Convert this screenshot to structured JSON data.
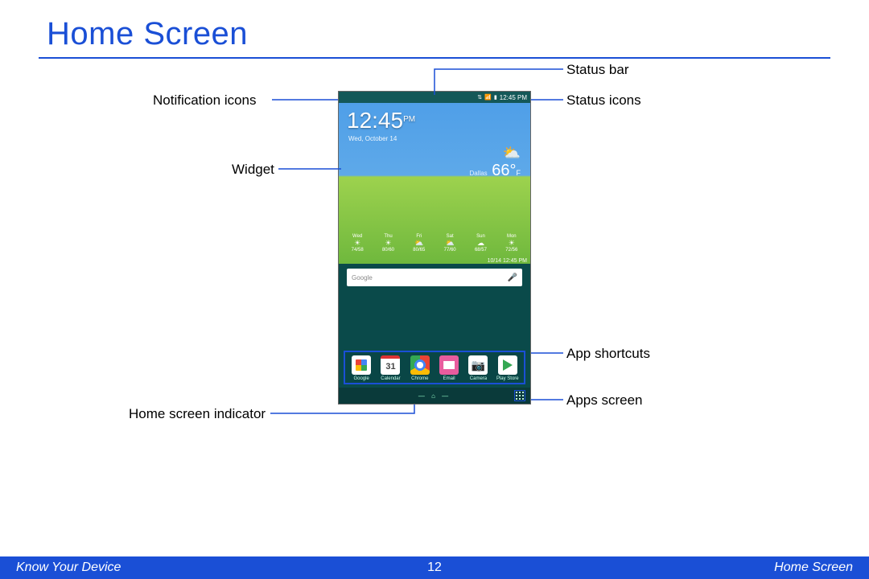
{
  "title": "Home Screen",
  "callouts": {
    "notification_icons": "Notification icons",
    "widget": "Widget",
    "home_screen_indicator": "Home screen indicator",
    "status_bar": "Status bar",
    "status_icons": "Status icons",
    "app_shortcuts": "App shortcuts",
    "apps_screen": "Apps screen"
  },
  "phone": {
    "statusbar_time": "12:45 PM",
    "clock_time": "12:45",
    "clock_ampm": "PM",
    "clock_date": "Wed, October 14",
    "weather_city": "Dallas",
    "weather_temp": "66°",
    "weather_unit": "F",
    "weather_stamp": "10/14 12:45 PM",
    "forecast": [
      {
        "day": "Wed",
        "hi": "74",
        "lo": "58"
      },
      {
        "day": "Thu",
        "hi": "80",
        "lo": "60"
      },
      {
        "day": "Fri",
        "hi": "80",
        "lo": "65"
      },
      {
        "day": "Sat",
        "hi": "77",
        "lo": "60"
      },
      {
        "day": "Sun",
        "hi": "68",
        "lo": "57"
      },
      {
        "day": "Mon",
        "hi": "72",
        "lo": "56"
      }
    ],
    "search_placeholder": "Google",
    "calendar_day": "31",
    "dock": [
      {
        "label": "Google"
      },
      {
        "label": "Calendar"
      },
      {
        "label": "Chrome"
      },
      {
        "label": "Email"
      },
      {
        "label": "Camera"
      },
      {
        "label": "Play Store"
      }
    ]
  },
  "footer": {
    "left": "Know Your Device",
    "page": "12",
    "right": "Home Screen"
  }
}
